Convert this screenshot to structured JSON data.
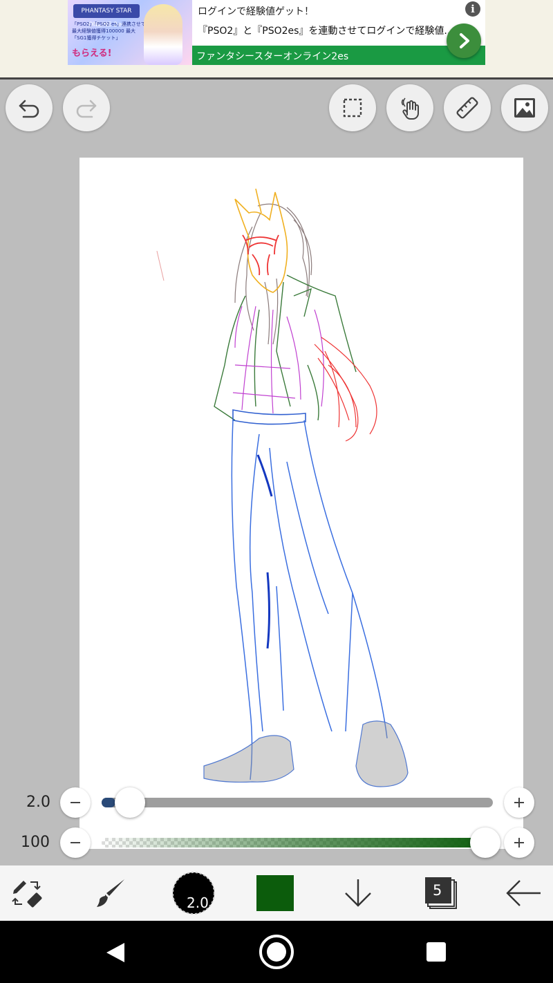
{
  "ad": {
    "image_logo": "PHANTASY STAR ONLINE 2es",
    "image_promo": "「PSO2」「PSO2 es」連携させて 最大経験値獲得100000 最大「SG1獲得チケット」",
    "image_promo_big": "もらえる!",
    "title": "ログインで経験値ゲット！",
    "info_icon": "i",
    "description": "『PSO2』と『PSO2es』を連動させてログインで経験値...",
    "source": "ファンタシースターオンライン2es"
  },
  "toolbar": {
    "icons": [
      "undo-icon",
      "redo-icon",
      "selection-icon",
      "hand-move-icon",
      "ruler-icon",
      "image-icon"
    ]
  },
  "brush_size": {
    "value_label": "2.0",
    "fraction": 0.0
  },
  "opacity": {
    "value_label": "100",
    "fraction": 1.0
  },
  "bottom_toolbar": {
    "brush_size_label": "2.0",
    "current_color": "#0c5c0c",
    "layer_count": "5"
  },
  "colors": {
    "accent_blue": "#2a4a78",
    "ad_green": "#1a9a43"
  }
}
